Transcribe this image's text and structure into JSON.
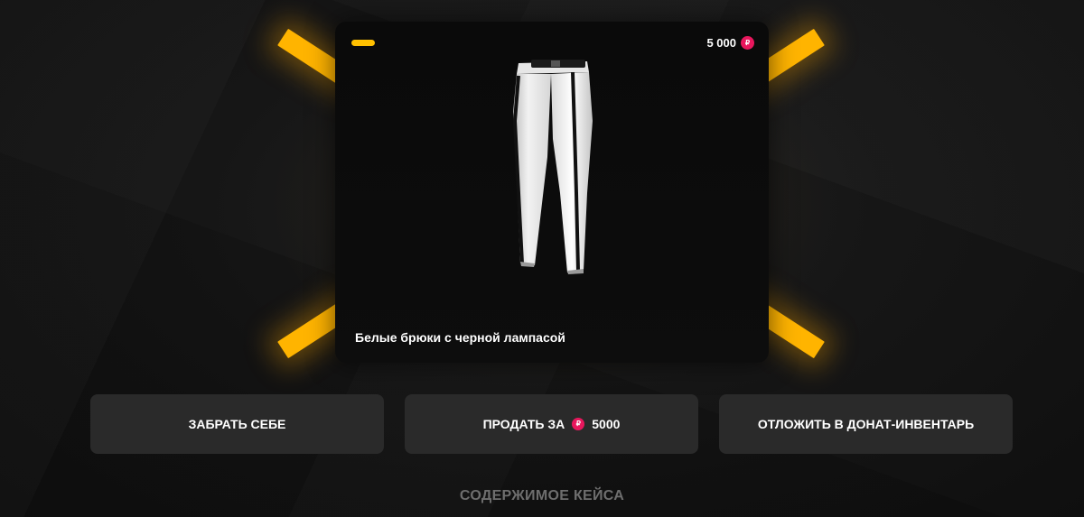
{
  "item": {
    "name": "Белые брюки с черной лампасой",
    "price": "5 000",
    "currency_icon": "rubl-coin-icon",
    "rarity_color": "#ffc000"
  },
  "actions": {
    "take_label": "ЗАБРАТЬ СЕБЕ",
    "sell_label": "ПРОДАТЬ ЗА",
    "sell_price": "5000",
    "defer_label": "ОТЛОЖИТЬ В ДОНАТ-ИНВЕНТАРЬ"
  },
  "section": {
    "title": "СОДЕРЖИМОЕ КЕЙСА"
  },
  "colors": {
    "accent": "#ffb400",
    "coin": "#e8175d",
    "button_bg": "#2a2a2a"
  }
}
